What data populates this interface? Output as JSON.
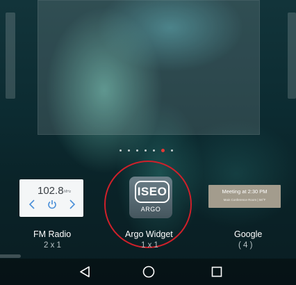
{
  "pager": {
    "dot_count": 7,
    "active_index": 5,
    "active_color": "#e53935"
  },
  "widgets": [
    {
      "name": "FM Radio",
      "size": "2 x 1",
      "preview": {
        "frequency": "102.8",
        "unit": "MHz",
        "icons": [
          "chevron-left-icon",
          "power-icon",
          "chevron-right-icon"
        ]
      }
    },
    {
      "name": "Argo Widget",
      "size": "1 x 1",
      "preview": {
        "logo_text": "ISEO",
        "sub_text": "ARGO"
      },
      "highlight_color": "#d0202a"
    },
    {
      "name": "Google",
      "size": "( 4 )",
      "preview": {
        "title": "Meeting at 2:30 PM",
        "subtitle": "Main Conference Room | 56°F"
      }
    }
  ],
  "nav": {
    "buttons": [
      "back-icon",
      "home-icon",
      "recents-icon"
    ]
  }
}
